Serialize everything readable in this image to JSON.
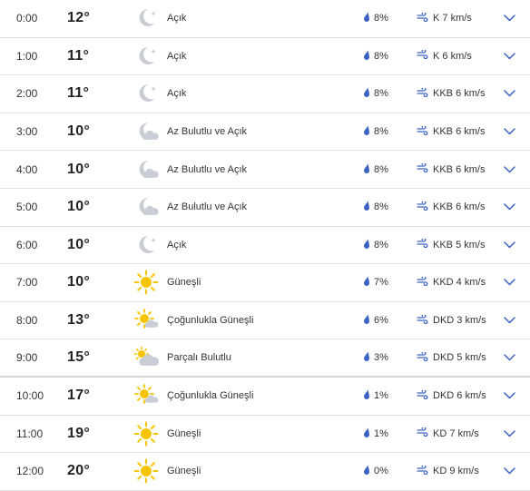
{
  "colors": {
    "accent": "#3b63c4",
    "sun": "#f7c500",
    "moon": "#c9ccd3",
    "cloud": "#c9ced6",
    "divider": "#e3e3e3"
  },
  "rows": [
    {
      "time": "0:00",
      "temp": "12°",
      "icon": "moon-icon",
      "condition": "Açık",
      "precip": "8%",
      "wind": "K 7 km/s"
    },
    {
      "time": "1:00",
      "temp": "11°",
      "icon": "moon-icon",
      "condition": "Açık",
      "precip": "8%",
      "wind": "K 6 km/s"
    },
    {
      "time": "2:00",
      "temp": "11°",
      "icon": "moon-icon",
      "condition": "Açık",
      "precip": "8%",
      "wind": "KKB 6 km/s"
    },
    {
      "time": "3:00",
      "temp": "10°",
      "icon": "moon-cloud-icon",
      "condition": "Az Bulutlu ve Açık",
      "precip": "8%",
      "wind": "KKB 6 km/s"
    },
    {
      "time": "4:00",
      "temp": "10°",
      "icon": "moon-cloud-icon",
      "condition": "Az Bulutlu ve Açık",
      "precip": "8%",
      "wind": "KKB 6 km/s"
    },
    {
      "time": "5:00",
      "temp": "10°",
      "icon": "moon-cloud-icon",
      "condition": "Az Bulutlu ve Açık",
      "precip": "8%",
      "wind": "KKB 6 km/s"
    },
    {
      "time": "6:00",
      "temp": "10°",
      "icon": "moon-icon",
      "condition": "Açık",
      "precip": "8%",
      "wind": "KKB 5 km/s"
    },
    {
      "time": "7:00",
      "temp": "10°",
      "icon": "sun-icon",
      "condition": "Güneşli",
      "precip": "7%",
      "wind": "KKD 4 km/s"
    },
    {
      "time": "8:00",
      "temp": "13°",
      "icon": "sun-cloud-icon",
      "condition": "Çoğunlukla Güneşli",
      "precip": "6%",
      "wind": "DKD 3 km/s"
    },
    {
      "time": "9:00",
      "temp": "15°",
      "icon": "cloud-sun-icon",
      "condition": "Parçalı Bulutlu",
      "precip": "3%",
      "wind": "DKD 5 km/s"
    },
    {
      "time": "10:00",
      "temp": "17°",
      "icon": "sun-cloud-icon",
      "condition": "Çoğunlukla Güneşli",
      "precip": "1%",
      "wind": "DKD 6 km/s"
    },
    {
      "time": "11:00",
      "temp": "19°",
      "icon": "sun-icon",
      "condition": "Güneşli",
      "precip": "1%",
      "wind": "KD 7 km/s"
    },
    {
      "time": "12:00",
      "temp": "20°",
      "icon": "sun-icon",
      "condition": "Güneşli",
      "precip": "0%",
      "wind": "KD 9 km/s"
    }
  ]
}
